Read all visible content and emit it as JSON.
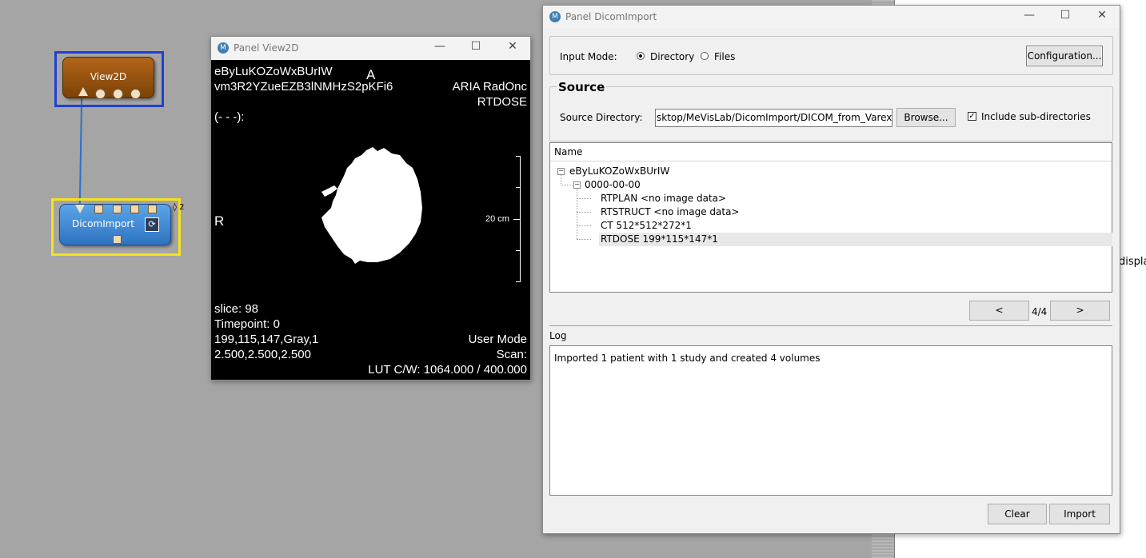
{
  "background": {
    "clipped_text": "displa"
  },
  "network": {
    "view2d_module": {
      "label": "View2D"
    },
    "dicom_module": {
      "label": "DicomImport",
      "refresh_glyph": "⟳"
    },
    "badge": {
      "glyph": "◊",
      "count": "2"
    },
    "colors": {
      "view2d_selection": "#2040d0",
      "dicom_selection": "#f5e21a",
      "connection": "#2d70c8"
    }
  },
  "view2d_panel": {
    "title": "Panel View2D",
    "overlay": {
      "patient_id": "eByLuKOZoWxBUrIW",
      "series_id": "vm3R2YZueEZB3lNMHzS2pKFi6",
      "orient_top": "A",
      "orient_left": "R",
      "device": "ARIA RadOnc",
      "modality": "RTDOSE",
      "window_info": "(- - -):",
      "scale": "20 cm",
      "slice": "slice:  98",
      "timepoint": "Timepoint: 0",
      "dims": "199,115,147,Gray,1",
      "spacing": "2.500,2.500,2.500",
      "user_mode": "User Mode",
      "scan": "Scan:",
      "lut": "LUT C/W: 1064.000 / 400.000"
    }
  },
  "dicom_panel": {
    "title": "Panel DicomImport",
    "input_mode": {
      "label": "Input Mode:",
      "options": [
        "Directory",
        "Files"
      ],
      "selected": "Directory"
    },
    "configuration_button": "Configuration...",
    "source": {
      "heading": "Source",
      "dir_label": "Source Directory:",
      "dir_value": "sktop/MeVisLab/DicomImport/DICOM_from_Varex",
      "browse_button": "Browse...",
      "include_subdirs_label": "Include sub-directories",
      "include_subdirs_checked": true
    },
    "tree": {
      "column_header": "Name",
      "patient": "eByLuKOZoWxBUrIW",
      "study": "0000-00-00",
      "series": [
        "RTPLAN <no image data>",
        "RTSTRUCT <no image data>",
        "CT 512*512*272*1",
        "RTDOSE 199*115*147*1"
      ],
      "selected_series": "RTDOSE 199*115*147*1"
    },
    "paging": {
      "prev": "<",
      "indicator": "4/4",
      "next": ">"
    },
    "log": {
      "label": "Log",
      "text": "Imported 1 patient with 1 study and created 4 volumes"
    },
    "clear_button": "Clear",
    "import_button": "Import"
  },
  "window_controls": {
    "minimize": "—",
    "maximize": "☐",
    "close": "✕"
  }
}
